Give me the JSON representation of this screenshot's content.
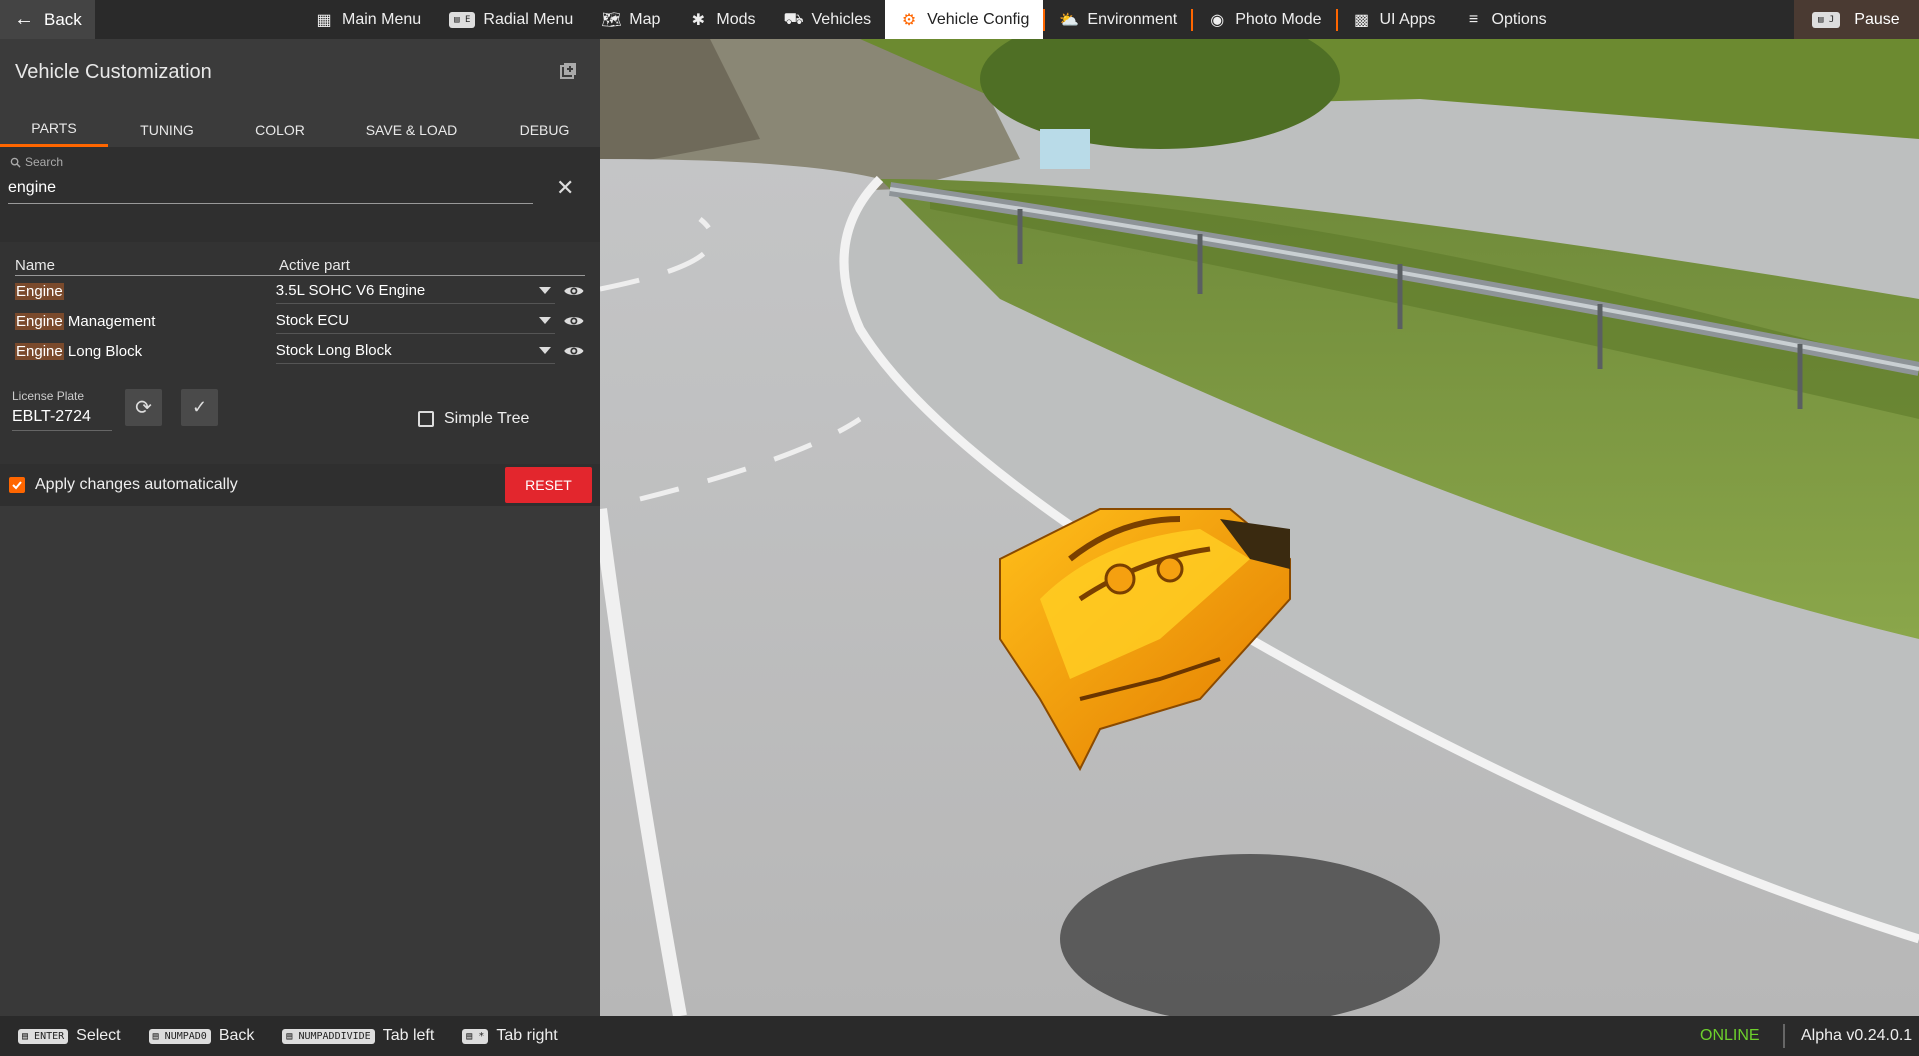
{
  "topbar": {
    "back_label": "Back",
    "items": [
      {
        "label": "Main Menu",
        "icon": "grid-icon"
      },
      {
        "label": "Radial Menu",
        "icon": "radial-menu-icon",
        "key": "E"
      },
      {
        "label": "Map",
        "icon": "map-icon"
      },
      {
        "label": "Mods",
        "icon": "puzzle-icon"
      },
      {
        "label": "Vehicles",
        "icon": "car-icon"
      },
      {
        "label": "Vehicle Config",
        "icon": "engine-icon",
        "active": true
      },
      {
        "label": "Environment",
        "icon": "weather-icon"
      },
      {
        "label": "Photo Mode",
        "icon": "camera-icon"
      },
      {
        "label": "UI Apps",
        "icon": "apps-icon"
      },
      {
        "label": "Options",
        "icon": "sliders-icon"
      }
    ],
    "pause_label": "Pause",
    "pause_key": "J",
    "accent": "#ff6600"
  },
  "panel": {
    "title": "Vehicle Customization",
    "tabs": [
      "PARTS",
      "TUNING",
      "COLOR",
      "SAVE & LOAD",
      "DEBUG"
    ],
    "active_tab": "PARTS",
    "search": {
      "label": "Search",
      "value": "engine"
    },
    "table": {
      "headers": {
        "name": "Name",
        "part": "Active part"
      },
      "rows": [
        {
          "highlight": "Engine",
          "rest": "",
          "part": "3.5L SOHC V6 Engine"
        },
        {
          "highlight": "Engine",
          "rest": " Management",
          "part": "Stock ECU"
        },
        {
          "highlight": "Engine",
          "rest": " Long Block",
          "part": "Stock Long Block"
        }
      ]
    },
    "license_plate": {
      "label": "License Plate",
      "value": "EBLT-2724"
    },
    "simple_tree": {
      "label": "Simple Tree",
      "checked": false
    },
    "apply_auto": {
      "label": "Apply changes automatically",
      "checked": true
    },
    "reset_label": "RESET",
    "reset_color": "#e3262d"
  },
  "bottombar": {
    "hints": [
      {
        "key": "ENTER",
        "label": "Select"
      },
      {
        "key": "NUMPAD0",
        "label": "Back"
      },
      {
        "key": "NUMPADDIVIDE",
        "label": "Tab left"
      },
      {
        "key": "*",
        "label": "Tab right"
      }
    ],
    "status": "ONLINE",
    "status_color": "#6dd12c",
    "version": "Alpha v0.24.0.1"
  }
}
